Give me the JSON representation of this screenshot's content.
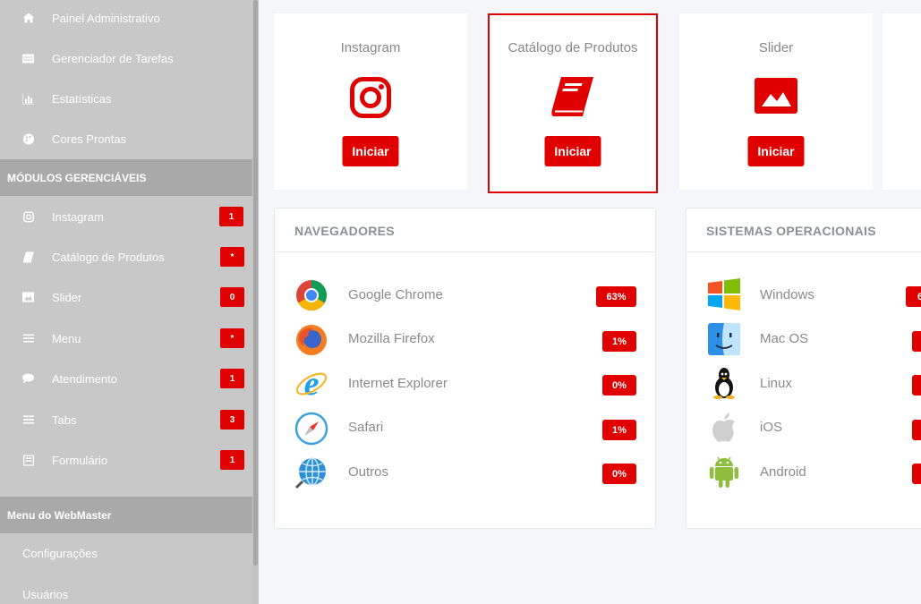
{
  "sidebar": {
    "top_items": [
      {
        "label": "Painel Administrativo",
        "icon": "home-icon"
      },
      {
        "label": "Gerenciador de Tarefas",
        "icon": "tasks-icon"
      },
      {
        "label": "Estatísticas",
        "icon": "chart-icon"
      },
      {
        "label": "Cores Prontas",
        "icon": "palette-icon"
      }
    ],
    "modules_header": "MÓDULOS GERENCIÁVEIS",
    "modules": [
      {
        "label": "Instagram",
        "icon": "instagram-icon",
        "badge": "1"
      },
      {
        "label": "Catálogo de Produtos",
        "icon": "book-icon",
        "badge": "*"
      },
      {
        "label": "Slider",
        "icon": "image-icon",
        "badge": "0"
      },
      {
        "label": "Menu",
        "icon": "menu-icon",
        "badge": "*"
      },
      {
        "label": "Atendimento",
        "icon": "chat-icon",
        "badge": "1"
      },
      {
        "label": "Tabs",
        "icon": "list-icon",
        "badge": "3"
      },
      {
        "label": "Formulário",
        "icon": "form-icon",
        "badge": "1"
      }
    ],
    "webmaster_header": "Menu do WebMaster",
    "webmaster_items": [
      "Configurações",
      "Usuários"
    ]
  },
  "modules": [
    {
      "title": "Instagram",
      "button": "Iniciar",
      "icon": "instagram-icon"
    },
    {
      "title": "Catálogo de Produtos",
      "button": "Iniciar",
      "icon": "book-icon"
    },
    {
      "title": "Slider",
      "button": "Iniciar",
      "icon": "image-icon"
    }
  ],
  "browsers": {
    "title": "NAVEGADORES",
    "rows": [
      {
        "label": "Google Chrome",
        "value": "63%",
        "icon": "chrome-icon"
      },
      {
        "label": "Mozilla Firefox",
        "value": "1%",
        "icon": "firefox-icon"
      },
      {
        "label": "Internet Explorer",
        "value": "0%",
        "icon": "ie-icon"
      },
      {
        "label": "Safari",
        "value": "1%",
        "icon": "safari-icon"
      },
      {
        "label": "Outros",
        "value": "0%",
        "icon": "globe-icon"
      }
    ]
  },
  "os": {
    "title": "SISTEMAS OPERACIONAIS",
    "rows": [
      {
        "label": "Windows",
        "value": "6",
        "icon": "windows-icon"
      },
      {
        "label": "Mac OS",
        "value": "",
        "icon": "macos-icon"
      },
      {
        "label": "Linux",
        "value": "",
        "icon": "linux-icon"
      },
      {
        "label": "iOS",
        "value": "",
        "icon": "apple-icon"
      },
      {
        "label": "Android",
        "value": "",
        "icon": "android-icon"
      }
    ]
  },
  "colors": {
    "accent": "#e00000",
    "sidebar": "#c8c8c8",
    "sidebar_header": "#a9a9a9"
  }
}
